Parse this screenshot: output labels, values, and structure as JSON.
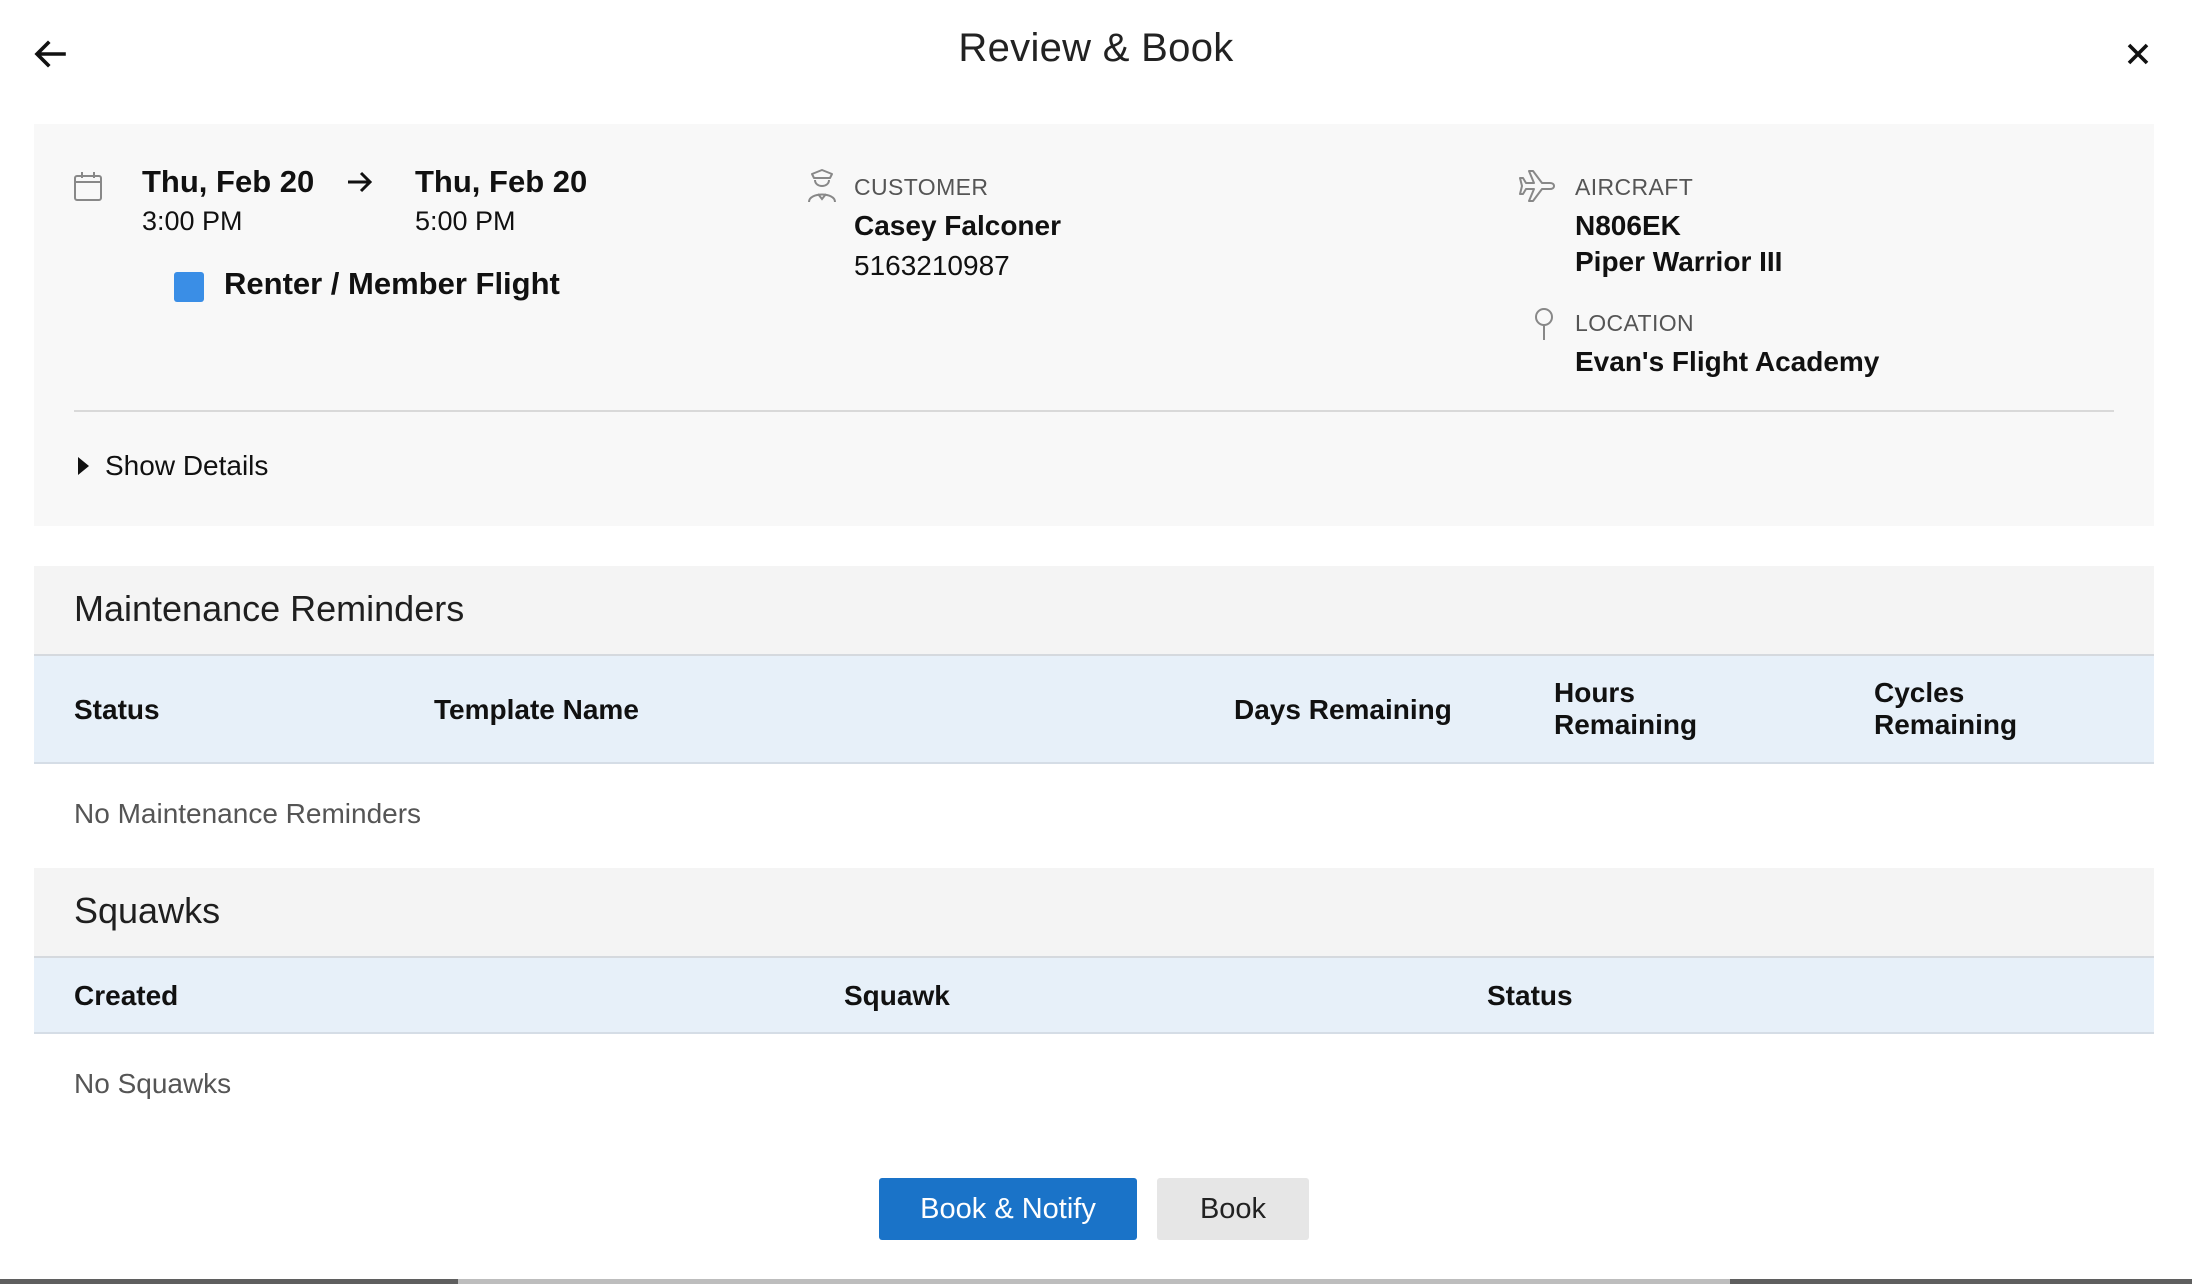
{
  "header": {
    "title": "Review & Book",
    "back_icon": "arrow-left-icon",
    "close_icon": "close-icon"
  },
  "booking": {
    "start_date": "Thu, Feb 20",
    "start_time": "3:00 PM",
    "end_date": "Thu, Feb 20",
    "end_time": "5:00 PM",
    "flight_type": "Renter / Member Flight",
    "flight_type_color": "#3a8ee6"
  },
  "customer": {
    "caption": "CUSTOMER",
    "name": "Casey Falconer",
    "phone": "5163210987"
  },
  "aircraft": {
    "caption": "AIRCRAFT",
    "tail": "N806EK",
    "model": "Piper Warrior III"
  },
  "location": {
    "caption": "LOCATION",
    "name": "Evan's Flight Academy"
  },
  "details_toggle": {
    "label": "Show Details"
  },
  "maintenance": {
    "title": "Maintenance Reminders",
    "columns": {
      "status": "Status",
      "template": "Template Name",
      "days": "Days Remaining",
      "hours_1": "Hours",
      "hours_2": "Remaining",
      "cycles_1": "Cycles",
      "cycles_2": "Remaining"
    },
    "empty": "No Maintenance Reminders"
  },
  "squawks": {
    "title": "Squawks",
    "columns": {
      "created": "Created",
      "squawk": "Squawk",
      "status": "Status"
    },
    "empty": "No Squawks"
  },
  "actions": {
    "book_notify": "Book & Notify",
    "book": "Book"
  },
  "colors": {
    "primary": "#1a73c8",
    "table_header_bg": "#e7f0f9",
    "section_bg": "#f4f4f4",
    "summary_bg": "#f8f8f8"
  }
}
